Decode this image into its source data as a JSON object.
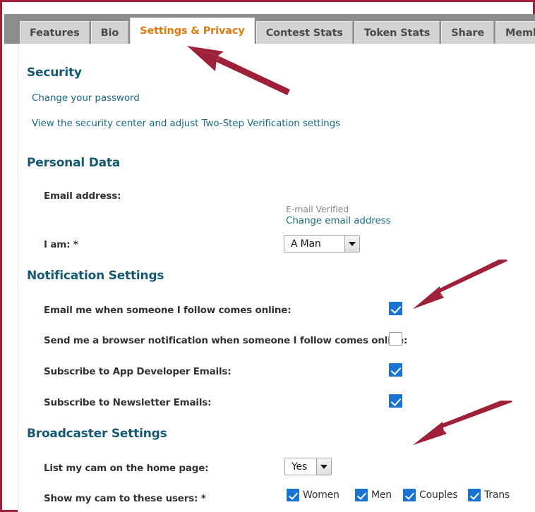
{
  "tabs": [
    {
      "label": "Features",
      "active": false
    },
    {
      "label": "Bio",
      "active": false
    },
    {
      "label": "Settings & Privacy",
      "active": true
    },
    {
      "label": "Contest Stats",
      "active": false
    },
    {
      "label": "Token Stats",
      "active": false
    },
    {
      "label": "Share",
      "active": false
    },
    {
      "label": "Memberships",
      "active": false
    }
  ],
  "security": {
    "heading": "Security",
    "change_password_link": "Change your password",
    "security_center_link": "View the security center and adjust Two-Step Verification settings"
  },
  "personal_data": {
    "heading": "Personal Data",
    "email_label": "Email address:",
    "email_verified_text": "E-mail Verified",
    "change_email_link": "Change email address",
    "i_am_label": "I am: *",
    "i_am_value": "A Man"
  },
  "notification_settings": {
    "heading": "Notification Settings",
    "rows": [
      {
        "label": "Email me when someone I follow comes online:",
        "checked": true
      },
      {
        "label": "Send me a browser notification when someone I follow comes online:",
        "checked": false
      },
      {
        "label": "Subscribe to App Developer Emails:",
        "checked": true
      },
      {
        "label": "Subscribe to Newsletter Emails:",
        "checked": true
      }
    ]
  },
  "broadcaster_settings": {
    "heading": "Broadcaster Settings",
    "list_cam_label": "List my cam on the home page:",
    "list_cam_value": "Yes",
    "show_cam_label": "Show my cam to these users: *",
    "user_types": [
      {
        "label": "Women",
        "checked": true
      },
      {
        "label": "Men",
        "checked": true
      },
      {
        "label": "Couples",
        "checked": true
      },
      {
        "label": "Trans",
        "checked": true
      }
    ]
  },
  "annotations": {
    "color": "#9e2039",
    "arrows": [
      {
        "name": "arrow-to-settings-privacy-tab"
      },
      {
        "name": "arrow-to-email-follow-checkbox"
      },
      {
        "name": "arrow-to-broadcaster-settings"
      }
    ]
  },
  "theme": {
    "frame_color": "#9e2039",
    "heading_color": "#155a72",
    "link_color": "#1b6b85",
    "active_tab_color": "#e07b12",
    "checkbox_color": "#1873d3",
    "tabstrip_bg": "#8c8c8c",
    "tab_bg": "#d3d3d3"
  }
}
